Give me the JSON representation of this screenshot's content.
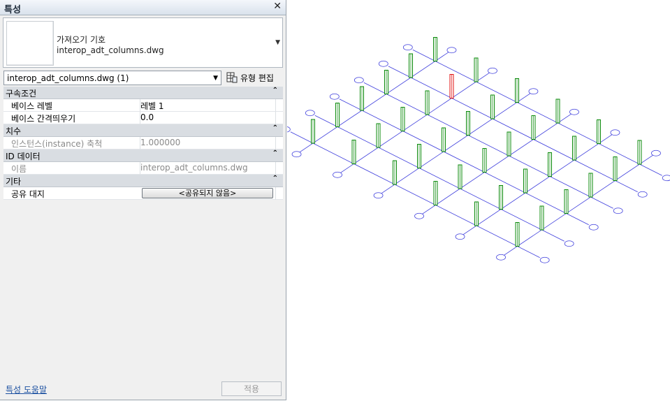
{
  "panel": {
    "title": "특성",
    "close_glyph": "✕",
    "type": {
      "category": "가져오기 기호",
      "family": "interop_adt_columns.dwg"
    },
    "selector": {
      "value": "interop_adt_columns.dwg (1)"
    },
    "edit_type_label": "유형 편집",
    "groups": [
      {
        "label": "구속조건",
        "collapse_glyph": "⌃",
        "rows": [
          {
            "name": "베이스 레벨",
            "value": "레벨 1"
          },
          {
            "name": "베이스 간격띄우기",
            "value": "0.0"
          }
        ]
      },
      {
        "label": "치수",
        "collapse_glyph": "⌃",
        "rows": [
          {
            "name": "인스턴스(instance) 축척",
            "value": "1.000000"
          }
        ]
      },
      {
        "label": "ID 데이터",
        "collapse_glyph": "⌃",
        "rows": [
          {
            "name": "이름",
            "value": "interop_adt_columns.dwg"
          }
        ]
      },
      {
        "label": "기타",
        "collapse_glyph": "⌃",
        "rows": [
          {
            "name": "공유 대지",
            "value": "<공유되지 않음>"
          }
        ]
      }
    ],
    "help_link": "특성 도움말",
    "apply_label": "적용"
  },
  "colors": {
    "grid_line": "#3c3cdc",
    "column": "#0a8a0a",
    "selected_column": "#e01010",
    "group_bg": "#d9dde2"
  },
  "icons": {
    "close": "close-icon",
    "dropdown": "chevron-down-icon",
    "edit_type": "edit-type-icon",
    "collapse": "collapse-icon"
  }
}
